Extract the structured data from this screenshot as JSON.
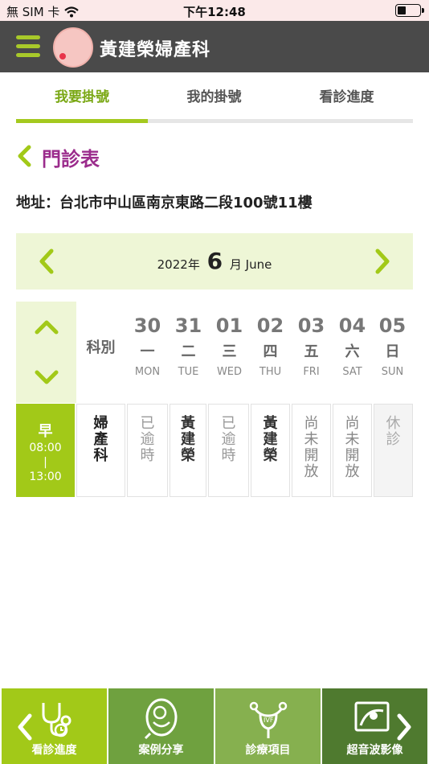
{
  "status_bar": {
    "carrier": "無 SIM 卡",
    "time": "下午12:48"
  },
  "header": {
    "title": "黃建榮婦產科",
    "accent": "#a8c92a"
  },
  "tabs": [
    {
      "label": "我要掛號",
      "active": true
    },
    {
      "label": "我的掛號",
      "active": false
    },
    {
      "label": "看診進度",
      "active": false
    }
  ],
  "section": {
    "title": "門診表"
  },
  "address": "地址：台北市中山區南京東路二段100號11樓",
  "month": {
    "year_text": "2022年",
    "month_num": "6",
    "month_suffix": "月",
    "month_en": "June"
  },
  "schedule": {
    "dept_header": "科別",
    "days": [
      {
        "date": "30",
        "cday": "一",
        "eday": "MON"
      },
      {
        "date": "31",
        "cday": "二",
        "eday": "TUE"
      },
      {
        "date": "01",
        "cday": "三",
        "eday": "WED"
      },
      {
        "date": "02",
        "cday": "四",
        "eday": "THU"
      },
      {
        "date": "03",
        "cday": "五",
        "eday": "FRI"
      },
      {
        "date": "04",
        "cday": "六",
        "eday": "SAT"
      },
      {
        "date": "05",
        "cday": "日",
        "eday": "SUN"
      }
    ],
    "session": {
      "name": "早",
      "start": "08:00",
      "sep": "|",
      "end": "13:00"
    },
    "dept": "婦產科",
    "slots": [
      "已逾時",
      "黃建榮",
      "已逾時",
      "黃建榮",
      "尚未開放",
      "尚未開放",
      "休診"
    ]
  },
  "bottom_nav": [
    {
      "label": "看診進度",
      "icon": "stethoscope-icon",
      "color": "#a2c918"
    },
    {
      "label": "案例分享",
      "icon": "baby-icon",
      "color": "#6fa13f"
    },
    {
      "label": "診療項目",
      "icon": "uterus-icon",
      "color": "#86b04f"
    },
    {
      "label": "超音波影像",
      "icon": "ultrasound-icon",
      "color": "#4f7a2f"
    }
  ]
}
